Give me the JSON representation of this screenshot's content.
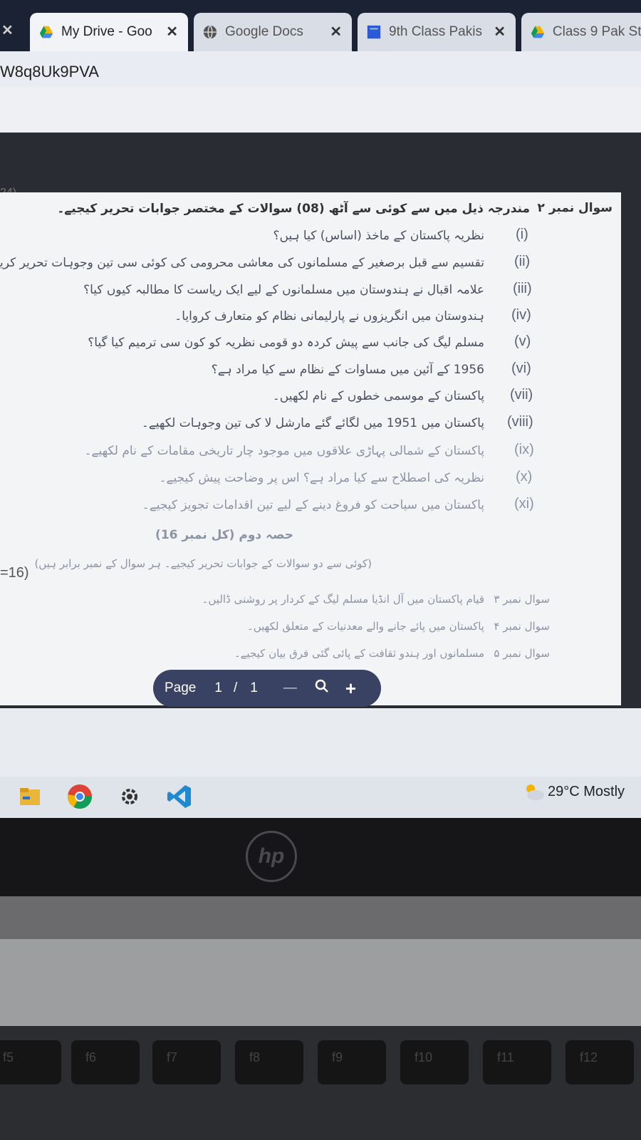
{
  "browser": {
    "tabs": [
      {
        "title": "My Drive - Goo",
        "close": "✕",
        "icon": "google-drive-icon",
        "active": true
      },
      {
        "title": "Google Docs",
        "close": "✕",
        "icon": "globe-icon",
        "active": false
      },
      {
        "title": "9th Class Pakis",
        "close": "✕",
        "icon": "doc-icon",
        "active": false
      },
      {
        "title": "Class 9 Pak St",
        "icon": "google-drive-icon",
        "active": false
      }
    ],
    "left_close": "✕",
    "url_fragment": "W8q8Uk9PVA"
  },
  "document": {
    "header_num": "سوال نمبر ۲",
    "header_text": "مندرجہ ذیل میں سے کوئی سے آٹھ (08) سوالات کے مختصر جوابات تحریر کیجیے۔",
    "questions": [
      {
        "num": "(i)",
        "text": "نظریہ پاکستان کے ماخذ (اساس) کیا ہیں؟"
      },
      {
        "num": "(ii)",
        "text": "تقسیم سے قبل برصغیر کے مسلمانوں کی معاشی محرومی کی کوئی سی تین وجوہات تحریر کریں۔"
      },
      {
        "num": "(iii)",
        "text": "علامہ اقبال نے ہندوستان میں مسلمانوں کے لیے ایک ریاست کا مطالبہ کیوں کیا؟"
      },
      {
        "num": "(iv)",
        "text": "ہندوستان میں انگریزوں نے پارلیمانی نظام کو متعارف کروایا۔"
      },
      {
        "num": "(v)",
        "text": "مسلم لیگ کی جانب سے پیش کردہ دو قومی نظریہ کو کون سی ترمیم کیا گیا؟"
      },
      {
        "num": "(vi)",
        "text": "1956 کے آئین میں مساوات کے نظام سے کیا مراد ہے؟"
      },
      {
        "num": "(vii)",
        "text": "پاکستان کے موسمی خطوں کے نام لکھیں۔"
      },
      {
        "num": "(viii)",
        "text": "پاکستان میں 1951 میں لگائے گئے مارشل لا کی تین وجوہات لکھیے۔"
      },
      {
        "num": "(ix)",
        "text": "پاکستان کے شمالی پہاڑی علاقوں میں موجود چار تاریخی مقامات کے نام لکھیے۔"
      },
      {
        "num": "(x)",
        "text": "نظریہ کی اصطلاح سے کیا مراد ہے؟ اس پر وضاحت پیش کیجیے۔"
      },
      {
        "num": "(xi)",
        "text": "پاکستان میں سیاحت کو فروغ دینے کے لیے تین اقدامات تجویز کیجیے۔"
      }
    ],
    "section_title": "حصہ دوم (کل نمبر 16)",
    "section_note": "(کوئی سے دو سوالات کے جوابات تحریر کیجیے۔ ہر سوال کے نمبر برابر ہیں)",
    "long_questions": [
      {
        "num": "سوال نمبر ۳",
        "text": "قیام پاکستان میں آل انڈیا مسلم لیگ کے کردار پر روشنی ڈالیں۔"
      },
      {
        "num": "سوال نمبر ۴",
        "text": "پاکستان میں پائے جانے والے معدنیات کے متعلق لکھیں۔"
      },
      {
        "num": "سوال نمبر ۵",
        "text": "مسلمانوں اور ہندو ثقافت کے پائی گئی فرق بیان کیجیے۔"
      }
    ],
    "left_margin_mark": "=16)",
    "top_left_mark": "24)"
  },
  "pdf_toolbar": {
    "page_label": "Page",
    "current_page": "1",
    "separator": "/",
    "total_pages": "1",
    "zoom_out": "—",
    "zoom_in": "+"
  },
  "taskbar": {
    "weather": "29°C  Mostly"
  },
  "laptop": {
    "logo": "hp",
    "fkeys": [
      "f5",
      "f6",
      "f7",
      "f8",
      "f9",
      "f10",
      "f11",
      "f12"
    ]
  }
}
